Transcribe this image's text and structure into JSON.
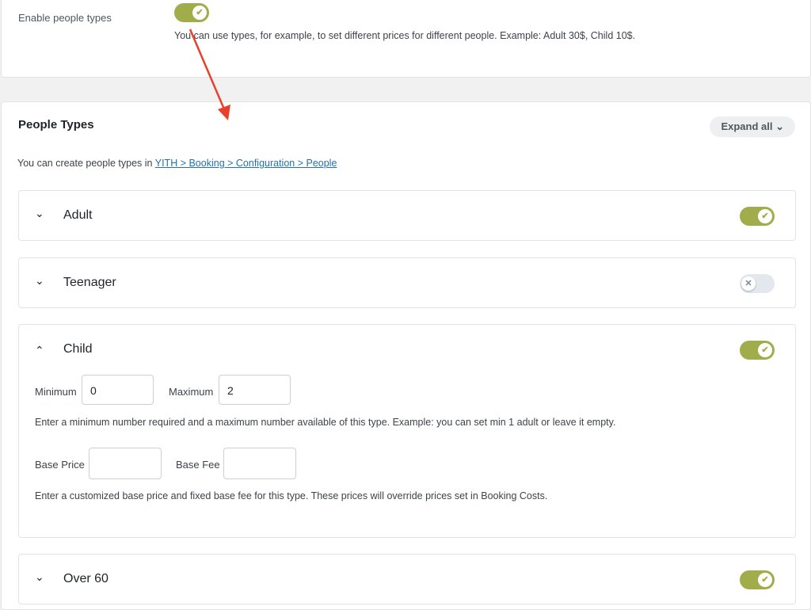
{
  "enable": {
    "label": "Enable people types",
    "enabled": true,
    "description": "You can use types, for example, to set different prices for different people. Example: Adult 30$, Child 10$."
  },
  "people_types": {
    "title": "People Types",
    "expand_all": "Expand all",
    "intro": "You can create people types in ",
    "link": "YITH > Booking > Configuration > People",
    "items": [
      {
        "name": "Adult",
        "expanded": false,
        "enabled": true
      },
      {
        "name": "Teenager",
        "expanded": false,
        "enabled": false
      },
      {
        "name": "Child",
        "expanded": true,
        "enabled": true,
        "minimum_label": "Minimum",
        "minimum": "0",
        "maximum_label": "Maximum",
        "maximum": "2",
        "minmax_help": "Enter a minimum number required and a maximum number available of this type. Example: you can set min 1 adult or leave it empty.",
        "base_price_label": "Base Price",
        "base_price": "",
        "base_fee_label": "Base Fee",
        "base_fee": "",
        "price_help": "Enter a customized base price and fixed base fee for this type. These prices will override prices set in Booking Costs."
      },
      {
        "name": "Over 60",
        "expanded": false,
        "enabled": true
      }
    ]
  },
  "colors": {
    "toggle_on": "#a0ad4a",
    "annotation_arrow": "#e8402a",
    "link": "#2271b1"
  },
  "icons": {
    "check": "✔",
    "cross": "✕",
    "chevron_down": "⌄",
    "chevron_up": "⌃"
  }
}
